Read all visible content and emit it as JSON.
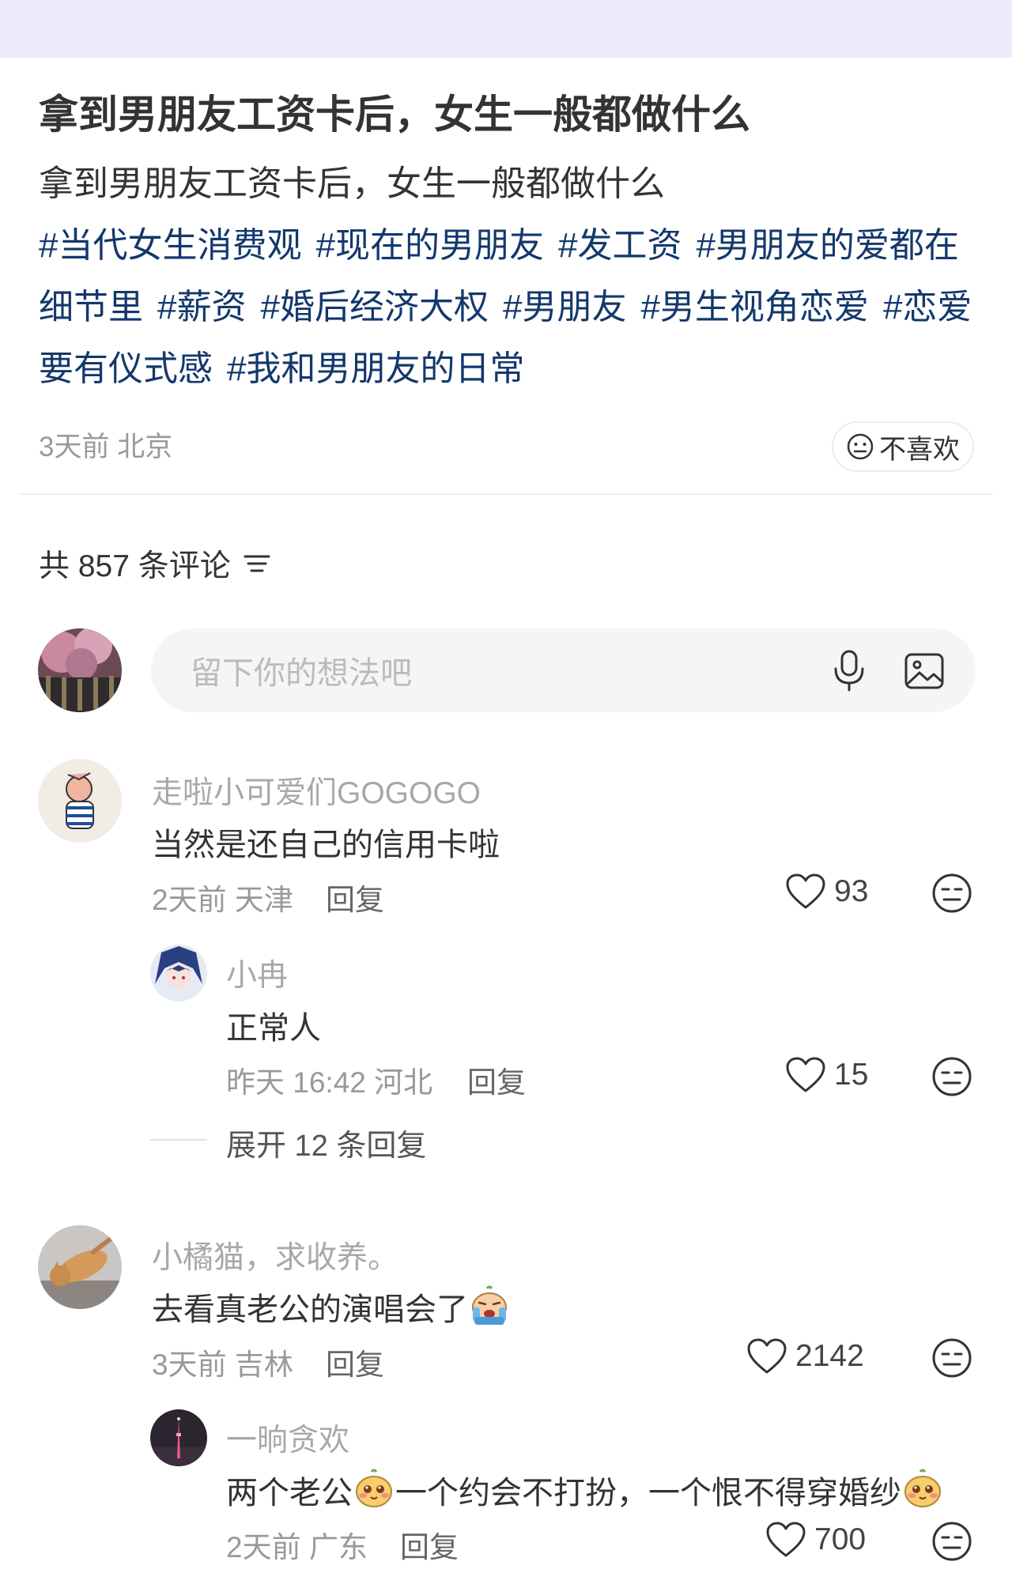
{
  "post": {
    "title": "拿到男朋友工资卡后，女生一般都做什么",
    "body": "拿到男朋友工资卡后，女生一般都做什么",
    "tags": [
      "#当代女生消费观",
      "#现在的男朋友",
      "#发工资",
      "#男朋友的爱都在细节里",
      "#薪资",
      "#婚后经济大权",
      "#男朋友",
      "#男生视角恋爱",
      "#恋爱要有仪式感",
      "#我和男朋友的日常"
    ],
    "meta": "3天前 北京",
    "dislike_label": "不喜欢"
  },
  "comments_header": {
    "count_label": "共 857 条评论"
  },
  "comment_input": {
    "placeholder": "留下你的想法吧"
  },
  "comments": [
    {
      "user": "走啦小可爱们GOGOGO",
      "text": "当然是还自己的信用卡啦",
      "meta": "2天前 天津",
      "reply_label": "回复",
      "likes": "93",
      "replies": [
        {
          "user": "小冉",
          "text": "正常人",
          "meta": "昨天 16:42 河北",
          "reply_label": "回复",
          "likes": "15"
        }
      ],
      "expand_label": "展开 12 条回复"
    },
    {
      "user": "小橘猫，求收养。",
      "text": "去看真老公的演唱会了",
      "meta": "3天前 吉林",
      "reply_label": "回复",
      "likes": "2142",
      "replies": [
        {
          "user": "一晌贪欢",
          "text_a": "两个老公",
          "text_b": "一个约会不打扮，一个恨不得穿婚纱",
          "meta": "2天前 广东",
          "reply_label": "回复",
          "likes": "700"
        }
      ]
    }
  ],
  "colors": {
    "tag": "#13386c",
    "top_band": "#ebeaf9",
    "input_bg": "#f5f5f7"
  }
}
